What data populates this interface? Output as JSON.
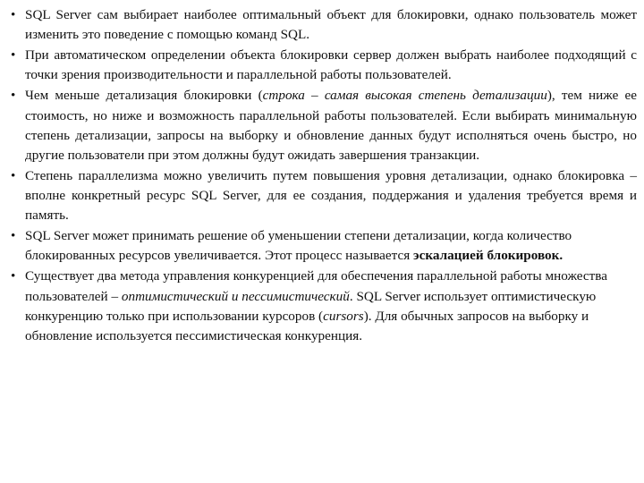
{
  "slide": {
    "bullet_glyph": "•",
    "text_color": "#111111",
    "background_color": "#ffffff",
    "bullets": [
      {
        "id": "bullet-lock-object-choice",
        "align": "justify",
        "parts": [
          {
            "style": "normal",
            "text": "SQL Server сам выбирает наиболее оптимальный объект для блокировки, однако пользователь может изменить это поведение с помощью команд SQL."
          }
        ]
      },
      {
        "id": "bullet-automatic-determination",
        "align": "justify",
        "parts": [
          {
            "style": "normal",
            "text": "При автоматическом определении объекта блокировки сервер должен выбрать наиболее подходящий с точки зрения производительности и параллельной работы пользователей."
          }
        ]
      },
      {
        "id": "bullet-granularity-cost",
        "align": "justify",
        "parts": [
          {
            "style": "normal",
            "text": "Чем меньше детализация блокировки ("
          },
          {
            "style": "italic",
            "text": "строка – самая высокая степень детализации"
          },
          {
            "style": "normal",
            "text": "), тем ниже ее стоимость, но ниже и возможность параллельной работы пользователей. Если выбирать минимальную степень детализации, запросы на выборку и обновление данных будут исполняться очень быстро, но другие пользователи при этом должны будут ожидать завершения транзакции."
          }
        ]
      },
      {
        "id": "bullet-parallelism-resources",
        "align": "justify",
        "parts": [
          {
            "style": "normal",
            "text": "Степень параллелизма можно увеличить путем повышения уровня детализации, однако блокировка – вполне конкретный ресурс SQL Server, для ее создания, поддержания и удаления требуется время и память."
          }
        ]
      },
      {
        "id": "bullet-lock-escalation",
        "align": "left",
        "parts": [
          {
            "style": "normal",
            "text": "SQL Server может принимать решение об уменьшении степени детализации, когда количество блокированных ресурсов увеличивается. Этот процесс называется "
          },
          {
            "style": "bold",
            "text": "эскалацией блокировок."
          }
        ]
      },
      {
        "id": "bullet-concurrency-methods",
        "align": "left",
        "parts": [
          {
            "style": "normal",
            "text": "Существует два метода управления конкуренцией для обеспечения параллельной работы множества пользователей – "
          },
          {
            "style": "italic",
            "text": "оптимистический и пессимистический"
          },
          {
            "style": "normal",
            "text": ". SQL Server использует оптимистическую конкуренцию только при использовании курсоров ("
          },
          {
            "style": "italic",
            "text": "cursors"
          },
          {
            "style": "normal",
            "text": "). Для обычных запросов на выборку и обновление используется пессимистическая конкуренция."
          }
        ]
      }
    ]
  }
}
